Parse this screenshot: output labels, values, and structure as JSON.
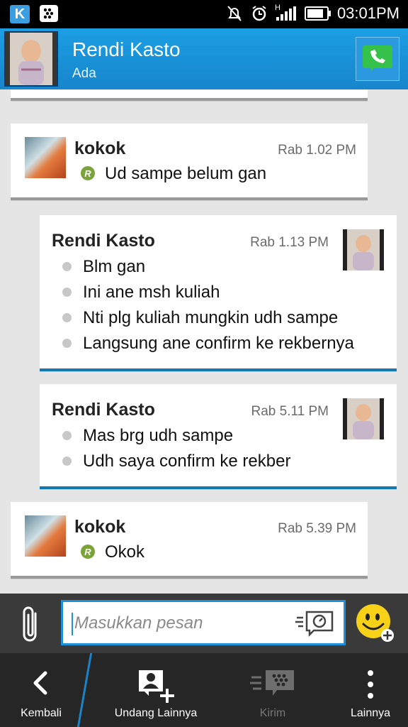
{
  "status_bar": {
    "time": "03:01PM",
    "network": "H",
    "icons": [
      "kakao-icon",
      "bbm-icon",
      "mute-icon",
      "alarm-icon",
      "signal-icon",
      "battery-icon"
    ]
  },
  "header": {
    "contact_name": "Rendi Kasto",
    "status": "Ada",
    "call_icon": "phone-icon",
    "accent": "#1c9ee4"
  },
  "messages": [
    {
      "sender": "kokok",
      "time": "Rab 1.02 PM",
      "direction": "in",
      "lines": [
        "Ud sampe belum gan"
      ],
      "read_badge": "R"
    },
    {
      "sender": "Rendi Kasto",
      "time": "Rab 1.13 PM",
      "direction": "out",
      "lines": [
        "Blm gan",
        "Ini ane msh kuliah",
        "Nti plg kuliah mungkin udh sampe",
        "Langsung ane confirm ke rekbernya"
      ]
    },
    {
      "sender": "Rendi Kasto",
      "time": "Rab 5.11 PM",
      "direction": "out",
      "lines": [
        "Mas brg udh sampe",
        "Udh saya confirm ke rekber"
      ]
    },
    {
      "sender": "kokok",
      "time": "Rab 5.39 PM",
      "direction": "in",
      "lines": [
        "Okok"
      ],
      "read_badge": "R"
    }
  ],
  "compose": {
    "placeholder": "Masukkan pesan",
    "value": ""
  },
  "nav": {
    "back": "Kembali",
    "invite": "Undang Lainnya",
    "send": "Kirim",
    "more": "Lainnya"
  }
}
